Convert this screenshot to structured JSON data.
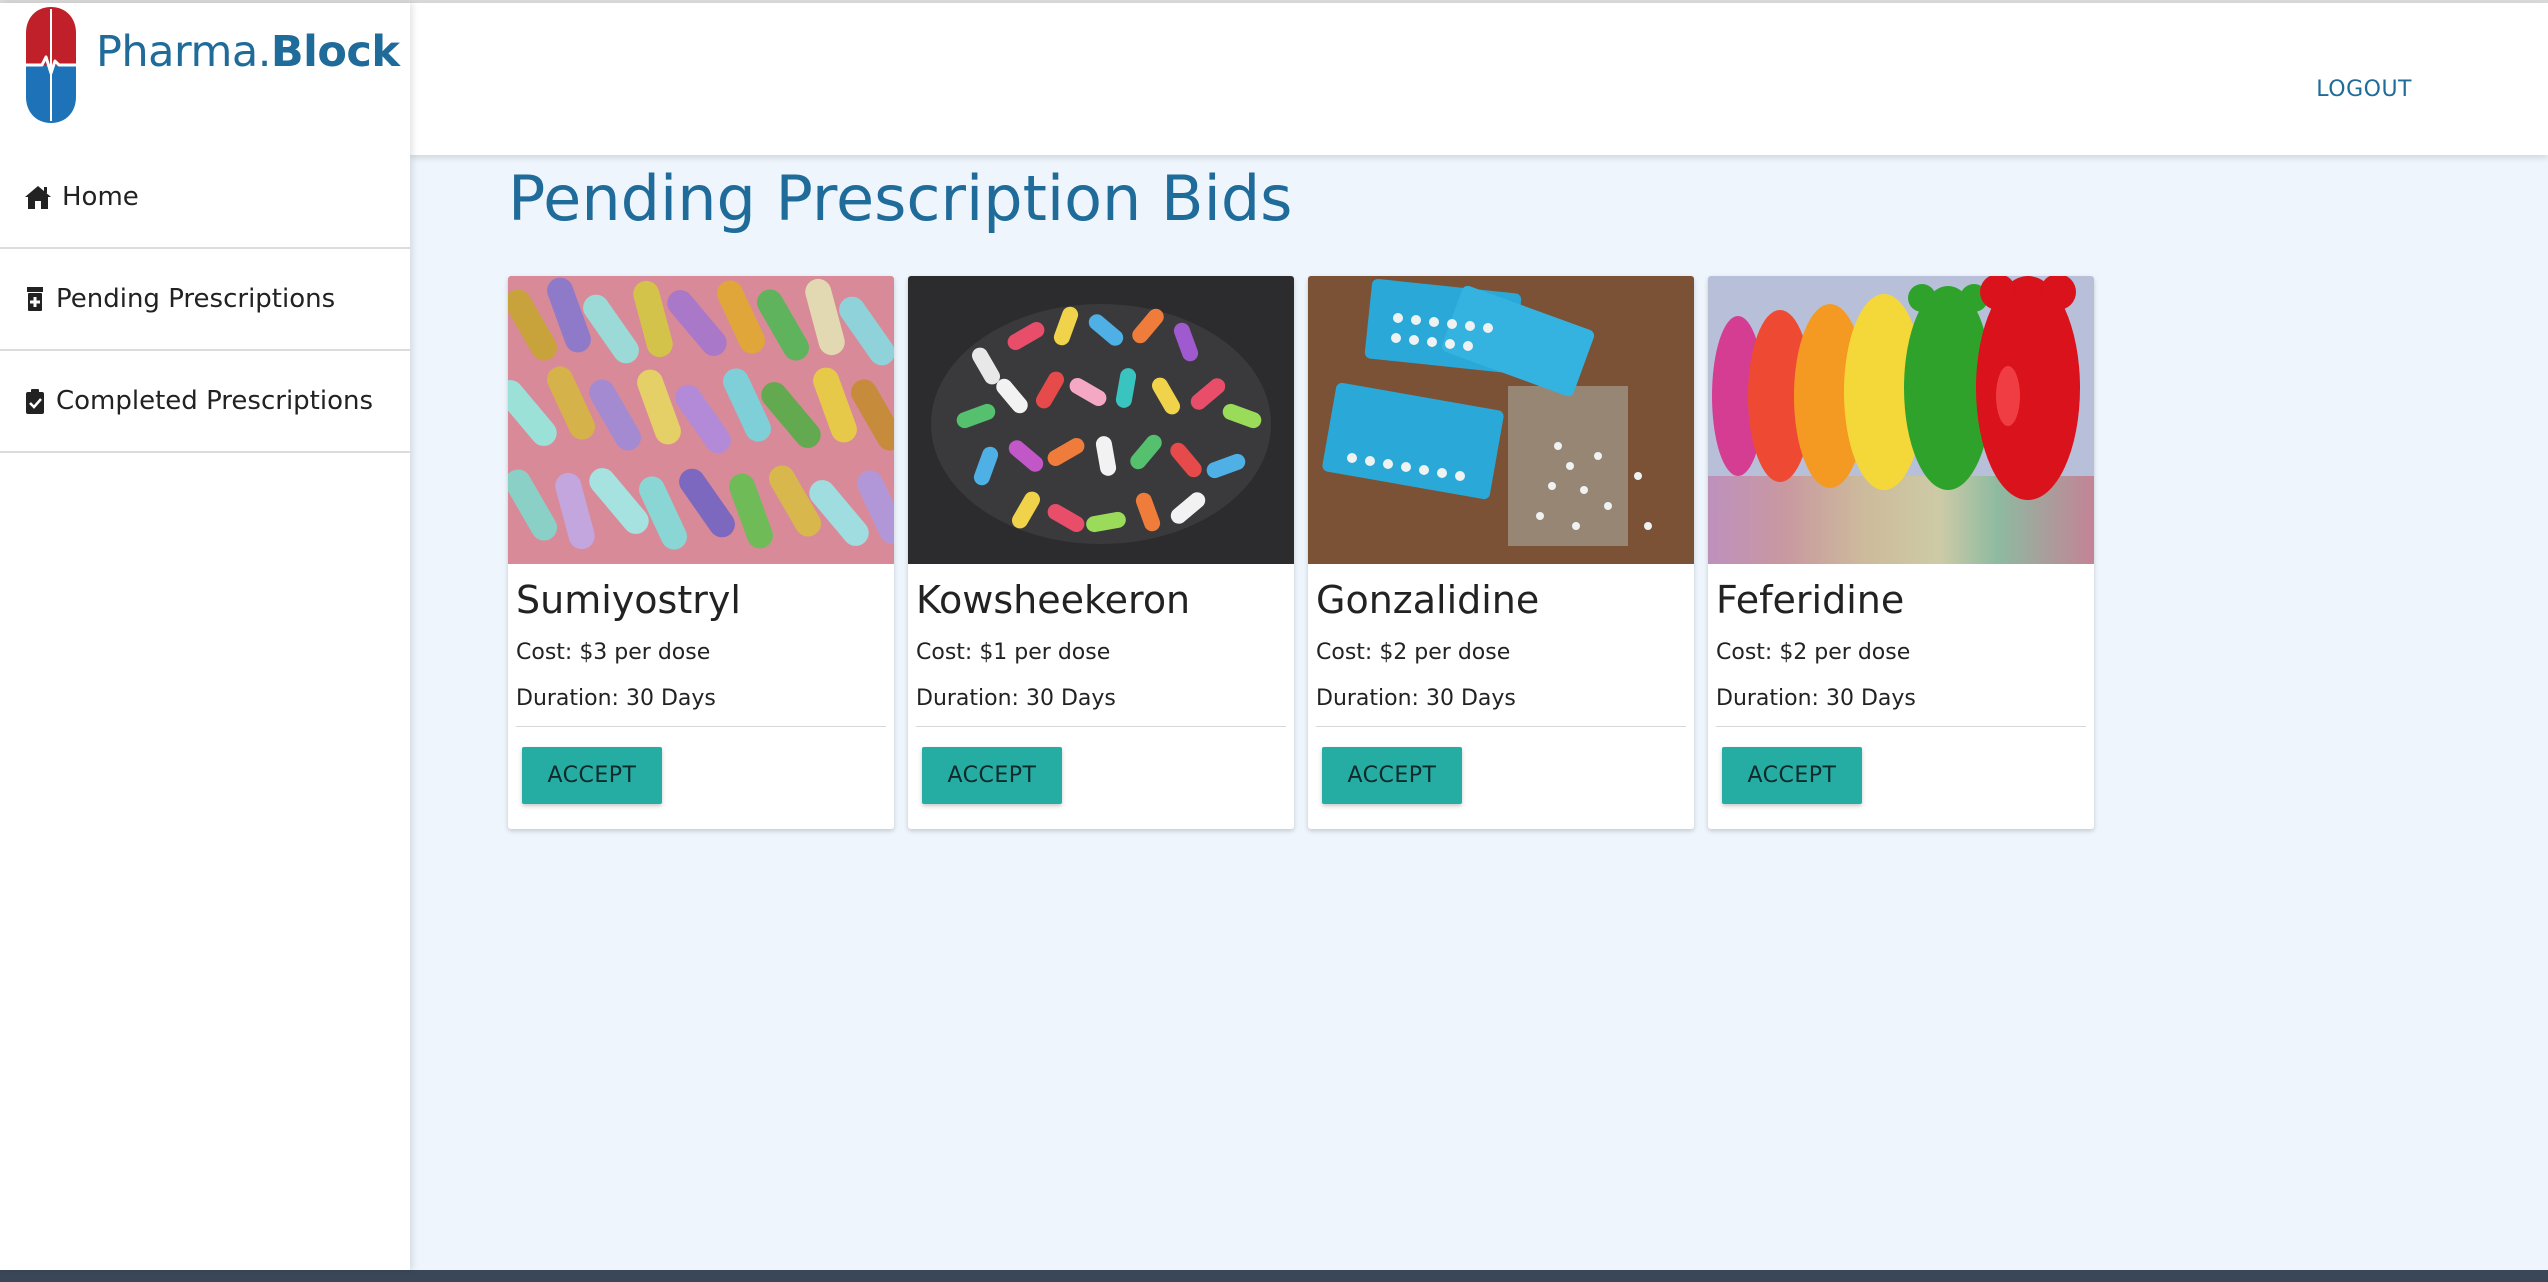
{
  "app": {
    "brand_prefix": "Pharma.",
    "brand_bold": "Block",
    "logo_colors": {
      "top": "#c0202a",
      "bottom": "#1e73b8"
    }
  },
  "sidebar": {
    "items": [
      {
        "label": "Home",
        "icon": "home-icon"
      },
      {
        "label": "Pending Prescriptions",
        "icon": "pill-bottle-icon"
      },
      {
        "label": "Completed Prescriptions",
        "icon": "clipboard-check-icon"
      }
    ]
  },
  "header": {
    "logout_label": "LOGOUT"
  },
  "main": {
    "title": "Pending Prescription Bids",
    "cards": [
      {
        "name": "Sumiyostryl",
        "cost": "Cost: $3 per dose",
        "duration": "Duration: 30 Days",
        "button": "ACCEPT",
        "image": "glitter-capsules-photo"
      },
      {
        "name": "Kowsheekeron",
        "cost": "Cost: $1 per dose",
        "duration": "Duration: 30 Days",
        "button": "ACCEPT",
        "image": "colorful-capsules-photo"
      },
      {
        "name": "Gonzalidine",
        "cost": "Cost: $2 per dose",
        "duration": "Duration: 30 Days",
        "button": "ACCEPT",
        "image": "blister-packs-photo"
      },
      {
        "name": "Feferidine",
        "cost": "Cost: $2 per dose",
        "duration": "Duration: 30 Days",
        "button": "ACCEPT",
        "image": "gummy-bears-photo"
      }
    ]
  },
  "colors": {
    "accent": "#1f6b99",
    "button": "#26ada3",
    "page_bg": "#eef5fc"
  }
}
